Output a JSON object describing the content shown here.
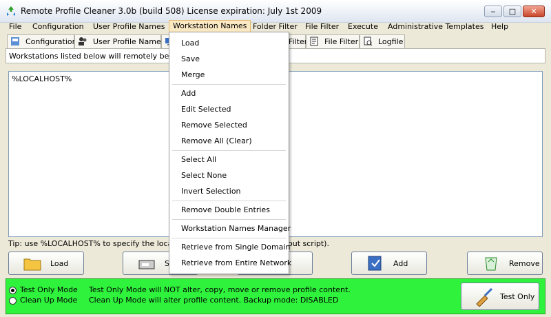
{
  "window": {
    "title": "Remote Profile Cleaner 3.0b (build 508)   License expiration: July 1st 2009",
    "controls": {
      "minimize": "‒",
      "maximize": "□",
      "close": "✕"
    },
    "icon": "recycle-icon"
  },
  "menubar": {
    "items": [
      {
        "label": "File"
      },
      {
        "label": "Configuration"
      },
      {
        "label": "User Profile Names"
      },
      {
        "label": "Workstation Names",
        "active": true
      },
      {
        "label": "Folder Filter"
      },
      {
        "label": "File Filter"
      },
      {
        "label": "Execute"
      },
      {
        "label": "Administrative Templates"
      },
      {
        "label": "Help"
      }
    ]
  },
  "tabs": [
    {
      "label": "Configuration",
      "icon": "configuration-icon"
    },
    {
      "label": "User Profile Names",
      "icon": "users-icon"
    },
    {
      "label": "Filter",
      "icon": "folder-filter-icon"
    },
    {
      "label": "File Filter",
      "icon": "file-filter-icon"
    },
    {
      "label": "Logfile",
      "icon": "logfile-icon"
    }
  ],
  "info_text": "Workstations listed below will remotely be cleaned",
  "list": {
    "items": [
      "%LOCALHOST%"
    ]
  },
  "tip": {
    "text": "Tip: use %LOCALHOST% to specify the local com",
    "end": "out script)."
  },
  "buttons": {
    "load": "Load",
    "save": "S",
    "merge": "ge",
    "add": "Add",
    "remove": "Remove"
  },
  "footer": {
    "bg_color": "#2ff23c",
    "test_mode_label": "Test Only Mode",
    "test_mode_desc": "Test Only Mode will NOT alter, copy, move or remove profile content.",
    "clean_mode_label": "Clean Up Mode",
    "clean_mode_desc": "Clean Up Mode will alter profile content. Backup mode: DISABLED",
    "selected": "test",
    "test_button": "Test Only"
  },
  "dropdown": {
    "groups": [
      [
        "Load",
        "Save",
        "Merge"
      ],
      [
        "Add",
        "Edit Selected",
        "Remove Selected",
        "Remove All (Clear)"
      ],
      [
        "Select All",
        "Select None",
        "Invert Selection"
      ],
      [
        "Remove Double Entries"
      ],
      [
        "Workstation Names Manager"
      ],
      [
        "Retrieve from Single Domain",
        "Retrieve from Entire Network"
      ]
    ]
  }
}
